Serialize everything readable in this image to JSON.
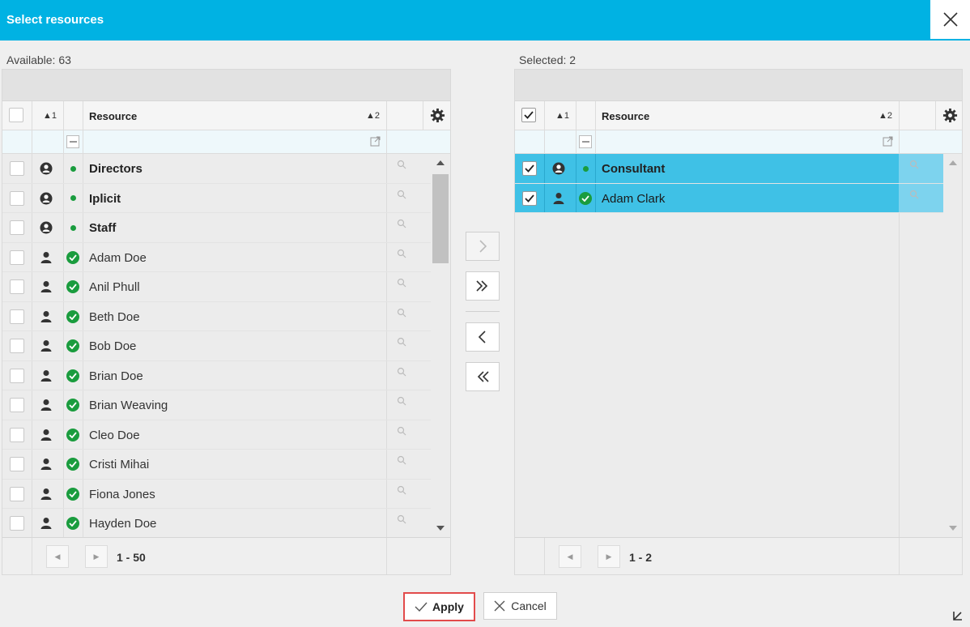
{
  "dialog": {
    "title": "Select resources"
  },
  "available": {
    "count_label": "Available: 63",
    "columns": {
      "sort1": "▲1",
      "resource": "Resource",
      "sort2": "▲2"
    },
    "rows": [
      {
        "name": "Directors",
        "kind": "group"
      },
      {
        "name": "Iplicit",
        "kind": "group"
      },
      {
        "name": "Staff",
        "kind": "group"
      },
      {
        "name": "Adam Doe",
        "kind": "person"
      },
      {
        "name": "Anil Phull",
        "kind": "person"
      },
      {
        "name": "Beth Doe",
        "kind": "person"
      },
      {
        "name": "Bob Doe",
        "kind": "person"
      },
      {
        "name": "Brian Doe",
        "kind": "person"
      },
      {
        "name": "Brian Weaving",
        "kind": "person"
      },
      {
        "name": "Cleo Doe",
        "kind": "person"
      },
      {
        "name": "Cristi Mihai",
        "kind": "person"
      },
      {
        "name": "Fiona Jones",
        "kind": "person"
      },
      {
        "name": "Hayden Doe",
        "kind": "person"
      }
    ],
    "pager_text": "1 - 50"
  },
  "selected": {
    "count_label": "Selected: 2",
    "columns": {
      "sort1": "▲1",
      "resource": "Resource",
      "sort2": "▲2"
    },
    "rows": [
      {
        "name": "Consultant",
        "kind": "group"
      },
      {
        "name": "Adam Clark",
        "kind": "person"
      }
    ],
    "pager_text": "1 - 2"
  },
  "actions": {
    "apply_label": "Apply",
    "cancel_label": "Cancel"
  },
  "colors": {
    "header": "#00b2e3",
    "selected_row": "#3fc1e6",
    "status_green": "#1a9c3e",
    "highlight_border": "#e24b4b"
  }
}
